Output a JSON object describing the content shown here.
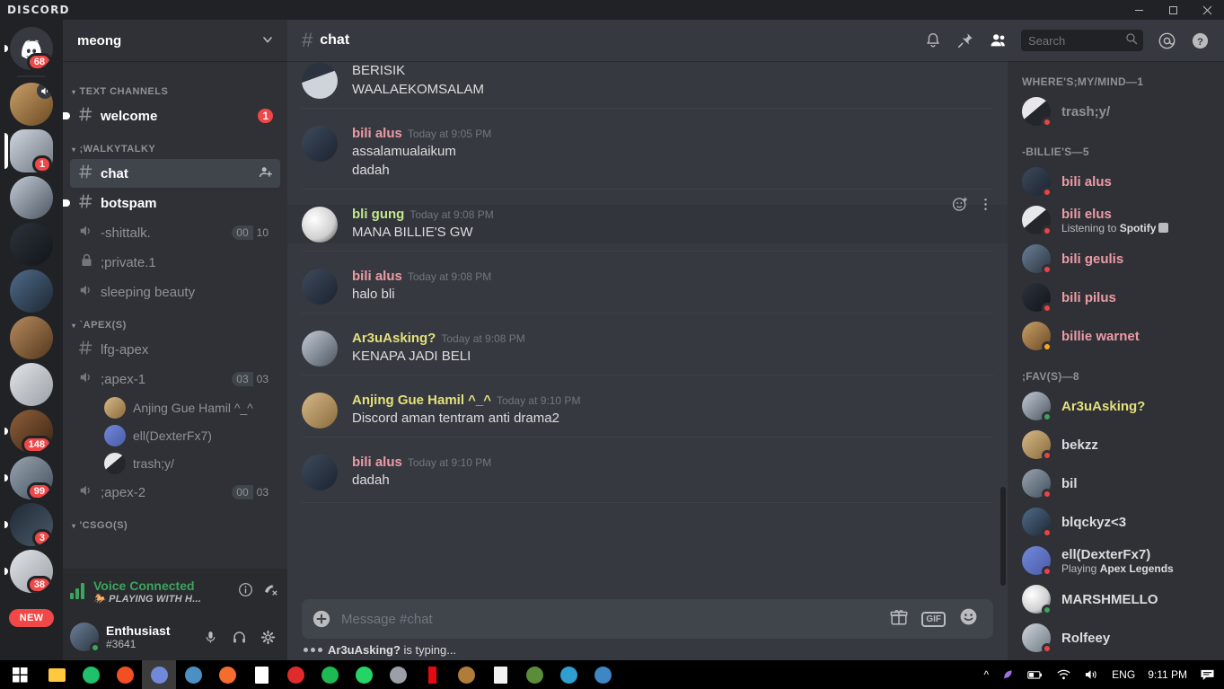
{
  "window": {
    "app_name": "DISCORD",
    "minimize": "—",
    "maximize": "▢",
    "close": "✕"
  },
  "server_rail": {
    "servers": [
      {
        "name": "discord-home",
        "badge": "68",
        "muted": false,
        "selected": false,
        "style": "home"
      },
      {
        "name": "server-cat",
        "badge": "",
        "muted": true,
        "selected": false,
        "style": "g12"
      },
      {
        "name": "server-portrait",
        "badge": "1",
        "muted": false,
        "selected": true,
        "style": "g3"
      },
      {
        "name": "server-snow",
        "badge": "",
        "muted": false,
        "selected": false,
        "style": "g8"
      },
      {
        "name": "server-face",
        "badge": "",
        "muted": false,
        "selected": false,
        "style": "g10"
      },
      {
        "name": "server-aot",
        "badge": "",
        "muted": false,
        "selected": false,
        "style": "g13"
      },
      {
        "name": "server-garuda",
        "badge": "",
        "muted": false,
        "selected": false,
        "style": "g7"
      },
      {
        "name": "server-b",
        "badge": "",
        "muted": false,
        "selected": false,
        "style": "g11"
      },
      {
        "name": "server-jd",
        "badge": "148",
        "muted": false,
        "selected": false,
        "style": "g15"
      },
      {
        "name": "server-shield",
        "badge": "99",
        "muted": false,
        "selected": false,
        "style": "g6"
      },
      {
        "name": "server-dark",
        "badge": "3",
        "muted": false,
        "selected": false,
        "style": "g17"
      },
      {
        "name": "server-jgrp",
        "badge": "38",
        "muted": false,
        "selected": false,
        "style": "g11"
      }
    ],
    "new_label": "NEW"
  },
  "sidebar": {
    "server_name": "meong",
    "categories": [
      {
        "label": "TEXT CHANNELS",
        "channels": [
          {
            "name": "welcome",
            "type": "text",
            "state": "unread",
            "mentions": "1"
          }
        ]
      },
      {
        "label": ";WALKYTALKY",
        "channels": [
          {
            "name": "chat",
            "type": "text",
            "state": "active",
            "action": "add-member"
          },
          {
            "name": "botspam",
            "type": "text",
            "state": "unread"
          },
          {
            "name": "-shittalk.",
            "type": "voice",
            "state": "normal",
            "users": "00",
            "limit": "10"
          },
          {
            "name": ";private.1",
            "type": "locked",
            "state": "normal"
          },
          {
            "name": "sleeping beauty",
            "type": "voice",
            "state": "normal"
          }
        ]
      },
      {
        "label": "`APEX(S)",
        "channels": [
          {
            "name": "lfg-apex",
            "type": "text",
            "state": "normal"
          },
          {
            "name": ";apex-1",
            "type": "voice",
            "state": "normal",
            "users": "03",
            "limit": "03",
            "members": [
              {
                "name": "Anjing Gue Hamil ^_^",
                "style": "g1"
              },
              {
                "name": "ell(DexterFx7)",
                "style": "g9"
              },
              {
                "name": "trash;y/",
                "style": "g5"
              }
            ]
          },
          {
            "name": ";apex-2",
            "type": "voice",
            "state": "normal",
            "users": "00",
            "limit": "03"
          }
        ]
      },
      {
        "label": "'CSGO(S)",
        "channels": []
      }
    ],
    "voice_panel": {
      "status": "Voice Connected",
      "channel": "PLAYING WITH H...",
      "info_icon": "info-icon",
      "disconnect_icon": "disconnect-call-icon"
    },
    "user_panel": {
      "username": "Enthusiast",
      "tag": "#3641",
      "status_color": "#3ba55d",
      "mute_icon": "microphone-icon",
      "deafen_icon": "headphones-icon",
      "settings_icon": "gear-icon"
    }
  },
  "channel_header": {
    "hash": "#",
    "title": "chat",
    "icons": [
      "bell-icon",
      "pin-icon",
      "members-icon",
      "mention-icon",
      "help-icon"
    ]
  },
  "search": {
    "placeholder": "Search",
    "value": "",
    "icon": "search-icon"
  },
  "messages": [
    {
      "author": "",
      "time": "",
      "continuation": true,
      "avatar_style": "g14",
      "lines": [
        "BERISIK",
        "WAALAEKOMSALAM"
      ],
      "name_color": "#ed9ba6"
    },
    {
      "author": "bili alus",
      "time": "Today at 9:05 PM",
      "avatar_style": "g4",
      "lines": [
        "assalamualaikum",
        "dadah"
      ],
      "name_color": "#ed9ba6"
    },
    {
      "author": "bli gung",
      "time": "Today at 9:08 PM",
      "avatar_style": "g16",
      "lines": [
        "MANA BILLIE'S GW"
      ],
      "name_color": "#c3e88d",
      "hovered": true,
      "hover_icons": [
        "add-reaction-icon",
        "more-options-icon"
      ]
    },
    {
      "author": "bili alus",
      "time": "Today at 9:08 PM",
      "avatar_style": "g4",
      "lines": [
        "halo bli"
      ],
      "name_color": "#ed9ba6"
    },
    {
      "author": "Ar3uAsking?",
      "time": "Today at 9:08 PM",
      "avatar_style": "g8",
      "lines": [
        "KENAPA JADI BELI"
      ],
      "name_color": "#e3e07b"
    },
    {
      "author": "Anjing Gue Hamil ^_^",
      "time": "Today at 9:10 PM",
      "avatar_style": "g1",
      "lines": [
        "Discord aman tentram anti drama2"
      ],
      "name_color": "#e3e07b"
    },
    {
      "author": "bili alus",
      "time": "Today at 9:10 PM",
      "avatar_style": "g4",
      "lines": [
        "dadah"
      ],
      "name_color": "#ed9ba6"
    }
  ],
  "composer": {
    "placeholder": "Message #chat",
    "value": "",
    "plus_icon": "add-attachment-icon",
    "gift_icon": "gift-icon",
    "gif_label": "GIF",
    "emoji_icon": "emoji-icon"
  },
  "typing_indicator": {
    "user": "Ar3uAsking?",
    "text": " is typing..."
  },
  "member_list": {
    "groups": [
      {
        "label": "WHERE'S;MY/MIND—1",
        "members": [
          {
            "name": "trash;y/",
            "status": "dnd",
            "name_color": "#8e9297",
            "activity": "",
            "style": "g5"
          }
        ]
      },
      {
        "label": "-BILLIE'S—5",
        "members": [
          {
            "name": "bili alus",
            "status": "dnd",
            "name_color": "#ed9ba6",
            "activity": "",
            "style": "g4"
          },
          {
            "name": "bili elus",
            "status": "dnd",
            "name_color": "#ed9ba6",
            "activity": "Listening to",
            "activity_bold": "Spotify",
            "style": "g5"
          },
          {
            "name": "bili geulis",
            "status": "dnd",
            "name_color": "#ed9ba6",
            "activity": "",
            "style": "g2"
          },
          {
            "name": "bili pilus",
            "status": "dnd",
            "name_color": "#ed9ba6",
            "activity": "",
            "style": "g10"
          },
          {
            "name": "billie warnet",
            "status": "idle",
            "name_color": "#ed9ba6",
            "activity": "",
            "style": "g12"
          }
        ]
      },
      {
        "label": ";FAV(S)—8",
        "members": [
          {
            "name": "Ar3uAsking?",
            "status": "online",
            "name_color": "#e3e07b",
            "activity": "",
            "style": "g8"
          },
          {
            "name": "bekzz",
            "status": "dnd",
            "name_color": "#dcddde",
            "activity": "",
            "style": "g1"
          },
          {
            "name": "bil",
            "status": "dnd",
            "name_color": "#dcddde",
            "activity": "",
            "style": "g6"
          },
          {
            "name": "blqckyz<3",
            "status": "dnd",
            "name_color": "#dcddde",
            "activity": "",
            "style": "g13"
          },
          {
            "name": "ell(DexterFx7)",
            "status": "dnd",
            "name_color": "#dcddde",
            "activity": "Playing",
            "activity_bold": "Apex Legends",
            "style": "g9"
          },
          {
            "name": "MARSHMELLO",
            "status": "online",
            "name_color": "#dcddde",
            "activity": "",
            "style": "g16"
          },
          {
            "name": "Rolfeey",
            "status": "dnd",
            "name_color": "#dcddde",
            "activity": "",
            "style": "g3"
          }
        ]
      }
    ],
    "status_colors": {
      "online": "#3ba55d",
      "idle": "#faa81a",
      "dnd": "#ed4245",
      "offline": "#747f8d"
    }
  },
  "taskbar": {
    "start_icon": "windows-start-icon",
    "apps": [
      {
        "name": "file-explorer",
        "color": "#ffc83d",
        "active": false
      },
      {
        "name": "location-app",
        "color": "#1fc16b",
        "active": false
      },
      {
        "name": "chrome",
        "color": "#f25022",
        "active": false
      },
      {
        "name": "discord",
        "color": "#7289da",
        "active": true
      },
      {
        "name": "steam-blue",
        "color": "#4a90c2",
        "active": false
      },
      {
        "name": "origin",
        "color": "#f56c2d",
        "active": false
      },
      {
        "name": "epic-games",
        "color": "#ffffff",
        "active": false
      },
      {
        "name": "red-app",
        "color": "#e02b2b",
        "active": false
      },
      {
        "name": "spotify",
        "color": "#1db954",
        "active": false
      },
      {
        "name": "whatsapp",
        "color": "#25d366",
        "active": false
      },
      {
        "name": "grey-app",
        "color": "#9aa0a6",
        "active": false
      },
      {
        "name": "netflix",
        "color": "#e50914",
        "active": false
      },
      {
        "name": "autodesk",
        "color": "#b07c3a",
        "active": false
      },
      {
        "name": "notepad",
        "color": "#f2f2f2",
        "active": false
      },
      {
        "name": "minecraft",
        "color": "#5b8c3a",
        "active": false
      },
      {
        "name": "blue-circle-app",
        "color": "#2f9fd0",
        "active": false
      },
      {
        "name": "steam",
        "color": "#3f87c4",
        "active": false
      }
    ],
    "tray": {
      "chevron": "^",
      "icons": [
        "feather-icon",
        "battery-icon",
        "wifi-icon",
        "volume-icon"
      ],
      "language": "ENG",
      "clock": "9:11 PM",
      "notifications": "notification-icon"
    }
  }
}
